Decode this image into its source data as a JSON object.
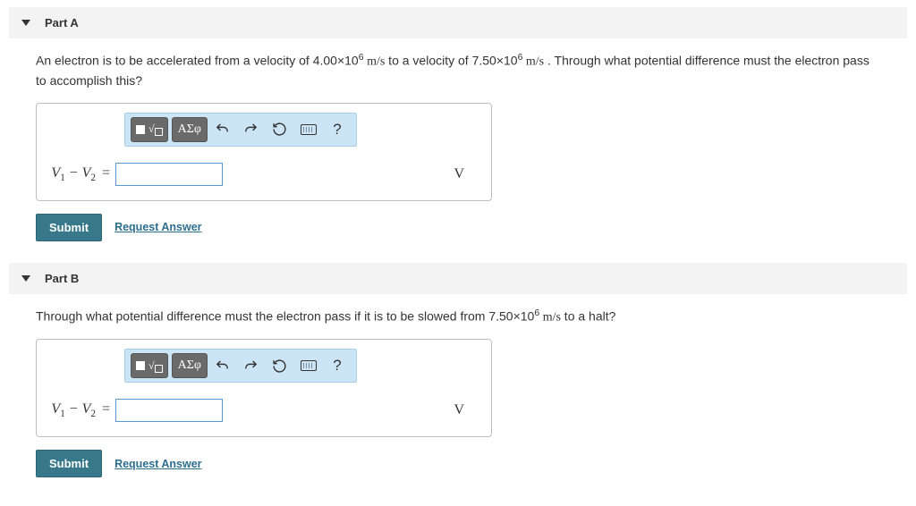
{
  "parts": [
    {
      "id": "A",
      "header": "Part A",
      "question_pre": "An electron is to be accelerated from a velocity of 4.00×10",
      "question_exp1": "6",
      "question_mid1": " m/s",
      "question_mid2": " to a velocity of 7.50×10",
      "question_exp2": "6",
      "question_mid3": " m/s",
      "question_post": " . Through what potential difference must the electron pass to accomplish this?",
      "lhs_html": "V1 − V2 =",
      "unit": "V",
      "submit": "Submit",
      "request": "Request Answer",
      "toolbar": {
        "greek": "ΑΣφ",
        "help": "?"
      }
    },
    {
      "id": "B",
      "header": "Part B",
      "question_pre": "Through what potential difference must the electron pass if it is to be slowed from 7.50×10",
      "question_exp1": "6",
      "question_mid1": " m/s",
      "question_mid2": " to a halt?",
      "question_exp2": "",
      "question_mid3": "",
      "question_post": "",
      "lhs_html": "V1 − V2 =",
      "unit": "V",
      "submit": "Submit",
      "request": "Request Answer",
      "toolbar": {
        "greek": "ΑΣφ",
        "help": "?"
      }
    }
  ]
}
